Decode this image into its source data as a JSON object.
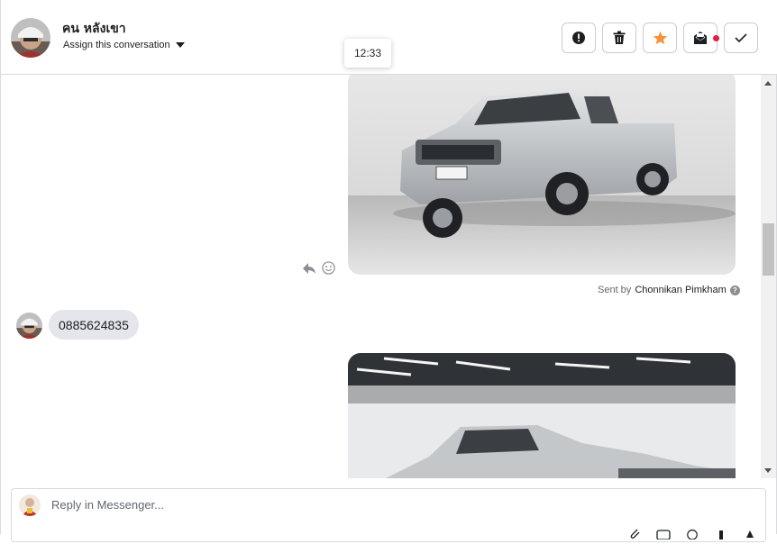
{
  "header": {
    "contact_name": "คน หลังเขา",
    "assign_label": "Assign this conversation",
    "actions": [
      {
        "name": "mark-spam-button",
        "icon": "alert-circle-icon"
      },
      {
        "name": "delete-button",
        "icon": "trash-icon"
      },
      {
        "name": "star-button",
        "icon": "star-icon"
      },
      {
        "name": "mark-unread-button",
        "icon": "envelope-icon"
      },
      {
        "name": "mark-done-button",
        "icon": "check-icon"
      }
    ]
  },
  "tooltip": {
    "time": "12:33"
  },
  "messages": {
    "sent_by_prefix": "Sent by",
    "sent_by_name": "Chonnikan Pimkham",
    "help_glyph": "?",
    "incoming_text": "0885624835"
  },
  "composer": {
    "placeholder": "Reply in Messenger..."
  },
  "colors": {
    "star": "#f7923b",
    "bubble": "#e4e6eb",
    "notification_dot": "#e41e3f"
  }
}
